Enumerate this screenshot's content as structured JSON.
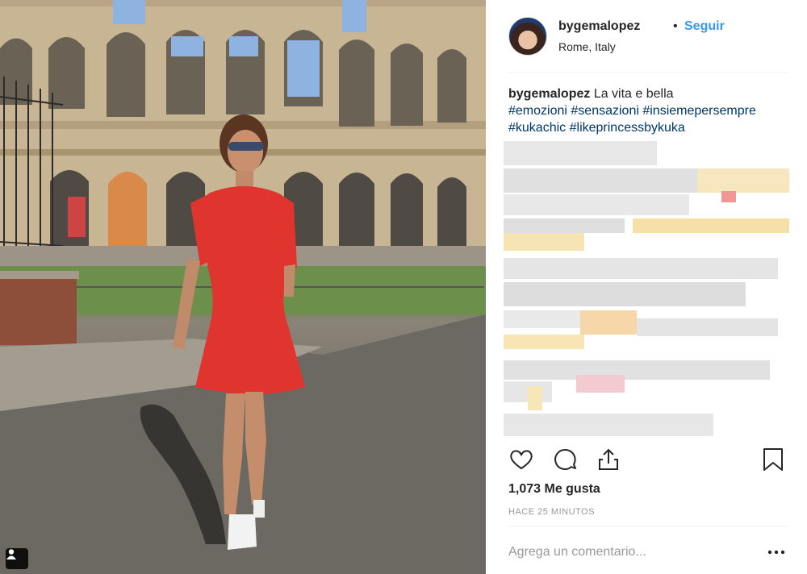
{
  "post": {
    "username": "bygemalopez",
    "separator": "•",
    "follow_label": "Seguir",
    "location": "Rome, Italy"
  },
  "caption": {
    "username": "bygemalopez",
    "text": "La vita e bella",
    "hashtags": [
      "#emozioni",
      "#sensazioni",
      "#insiemepersempre",
      "#kukachic",
      "#likeprincessbykuka"
    ]
  },
  "actions": {
    "icons": [
      "heart-icon",
      "comment-icon",
      "share-icon",
      "bookmark-icon"
    ]
  },
  "likes_label": "1,073 Me gusta",
  "timestamp": "HACE 25 MINUTOS",
  "comment": {
    "placeholder": "Agrega un comentario...",
    "more_icon": "more-options-icon"
  },
  "colors": {
    "link_blue": "#3897f0",
    "hashtag_blue": "#003569",
    "muted": "#999999"
  }
}
